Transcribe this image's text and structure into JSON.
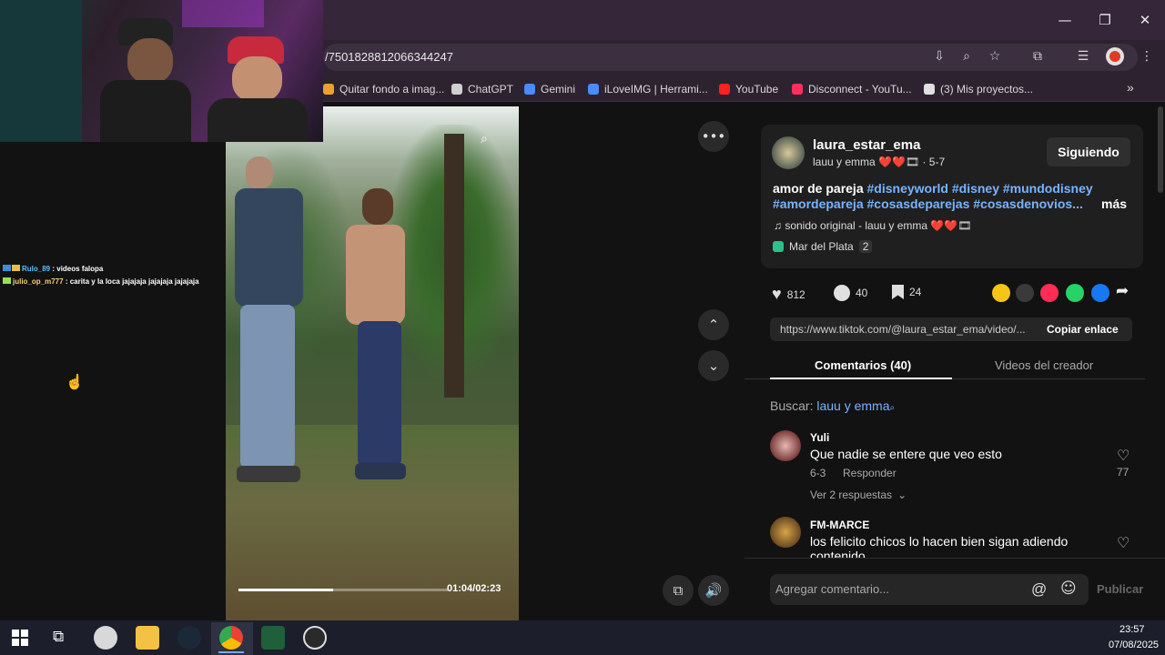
{
  "browser": {
    "url": "/7501828812066344247",
    "window_controls": [
      "minimize-icon",
      "restore-icon",
      "close-icon"
    ],
    "bookmarks": [
      {
        "label": "Quitar fondo a imag...",
        "color": "#f0a030"
      },
      {
        "label": "ChatGPT",
        "color": "#d0d0d0"
      },
      {
        "label": "Gemini",
        "color": "#4a8cff"
      },
      {
        "label": "iLoveIMG | Herrami...",
        "color": "#4a8cff"
      },
      {
        "label": "YouTube",
        "color": "#ff2020"
      },
      {
        "label": "Disconnect - YouTu...",
        "color": "#ff3060"
      },
      {
        "label": "(3)  Mis proyectos...",
        "color": "#e0e0e0"
      }
    ],
    "more_bookmarks": "»"
  },
  "chat": [
    {
      "user": "Rulo_89",
      "message": ": videos falopa",
      "user_color": "#5bc0ff"
    },
    {
      "user": "julio_op_m777",
      "message": ": carita y la loca jajajaja jajajaja jajajaja",
      "user_color": "#f5d36b"
    }
  ],
  "video": {
    "time": "01:04/02:23",
    "progress": 0.45
  },
  "post": {
    "username": "laura_estar_ema",
    "display": "lauu y emma ❤️❤️🎞 · 5-7",
    "follow_label": "Siguiendo",
    "caption_start": "amor de pareja ",
    "hashtags_line1": "#disneyworld #disney #mundodisney",
    "hashtags_line2": "#amordepareja #cosasdeparejas #cosasdenovios...",
    "more": "más",
    "sound": "♫  sonido original - lauu y emma ❤️❤️🎞",
    "location": "Mar del Plata",
    "location_count": "2",
    "likes": "812",
    "comments": "40",
    "saves": "24",
    "link": "https://www.tiktok.com/@laura_estar_ema/video/...",
    "copy_label": "Copiar enlace"
  },
  "tabs": {
    "comments": "Comentarios (40)",
    "creator_videos": "Videos del creador"
  },
  "search": {
    "prefix": "Buscar:",
    "term": "lauu y emma"
  },
  "comments": [
    {
      "user": "Yuli",
      "text": "Que nadie se entere que veo esto",
      "date": "6-3",
      "reply": "Responder",
      "likes": "77",
      "replies": "Ver 2 respuestas"
    },
    {
      "user": "FM-MARCE",
      "text": "los felicito chicos lo hacen bien sigan adiendo",
      "overflow": "contenido"
    }
  ],
  "composer": {
    "placeholder": "Agregar comentario...",
    "publish": "Publicar"
  },
  "taskbar": {
    "time": "23:57",
    "date": "07/08/2025"
  }
}
